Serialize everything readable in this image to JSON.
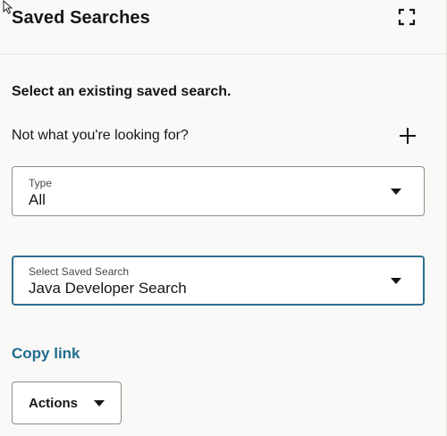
{
  "header": {
    "title": "Saved Searches",
    "expand_icon": "expand-icon"
  },
  "content": {
    "instruction": "Select an existing saved search.",
    "prompt": "Not what you're looking for?",
    "add_icon": "plus-icon"
  },
  "type_select": {
    "label": "Type",
    "value": "All"
  },
  "saved_search_select": {
    "label": "Select Saved Search",
    "value": "Java Developer Search"
  },
  "copy_link": "Copy link",
  "actions": {
    "label": "Actions"
  },
  "colors": {
    "background": "#faf9f7",
    "link": "#1f6b8f",
    "focus_border": "#2d6e8c",
    "text": "#161513"
  }
}
